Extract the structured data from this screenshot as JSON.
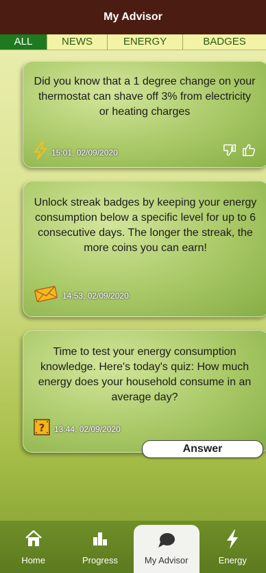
{
  "header": {
    "title": "My Advisor"
  },
  "tabs": [
    {
      "label": "ALL",
      "active": true
    },
    {
      "label": "NEWS",
      "active": false
    },
    {
      "label": "ENERGY",
      "active": false
    },
    {
      "label": "BADGES",
      "active": false
    }
  ],
  "cards": [
    {
      "text": "Did you know that a 1 degree change on your thermostat can shave off 3% from electricity or heating charges",
      "timestamp": "15:01, 02/09/2020",
      "icon": "lightning-icon"
    },
    {
      "text": "Unlock streak badges by keeping your energy consumption below a specific level for up to 6 consecutive days. The longer the streak, the more coins you can earn!",
      "timestamp": "14:53, 02/09/2020",
      "icon": "envelope-icon"
    },
    {
      "text": "Time to test your energy consumption knowledge. Here's today's quiz: How much energy does your household consume in an average day?",
      "timestamp": "13:44, 02/09/2020",
      "icon": "question-block-icon",
      "answer_label": "Answer"
    }
  ],
  "bottom_nav": [
    {
      "label": "Home",
      "icon": "home-icon"
    },
    {
      "label": "Progress",
      "icon": "bar-chart-icon"
    },
    {
      "label": "My Advisor",
      "icon": "chat-bubble-icon",
      "active": true
    },
    {
      "label": "Energy",
      "icon": "lightning-icon"
    }
  ],
  "colors": {
    "header_bg": "#4b1d12",
    "active_tab": "#1f7a1f",
    "tab_bar": "#f3f3a6",
    "nav_bg": "#6f8f28"
  }
}
